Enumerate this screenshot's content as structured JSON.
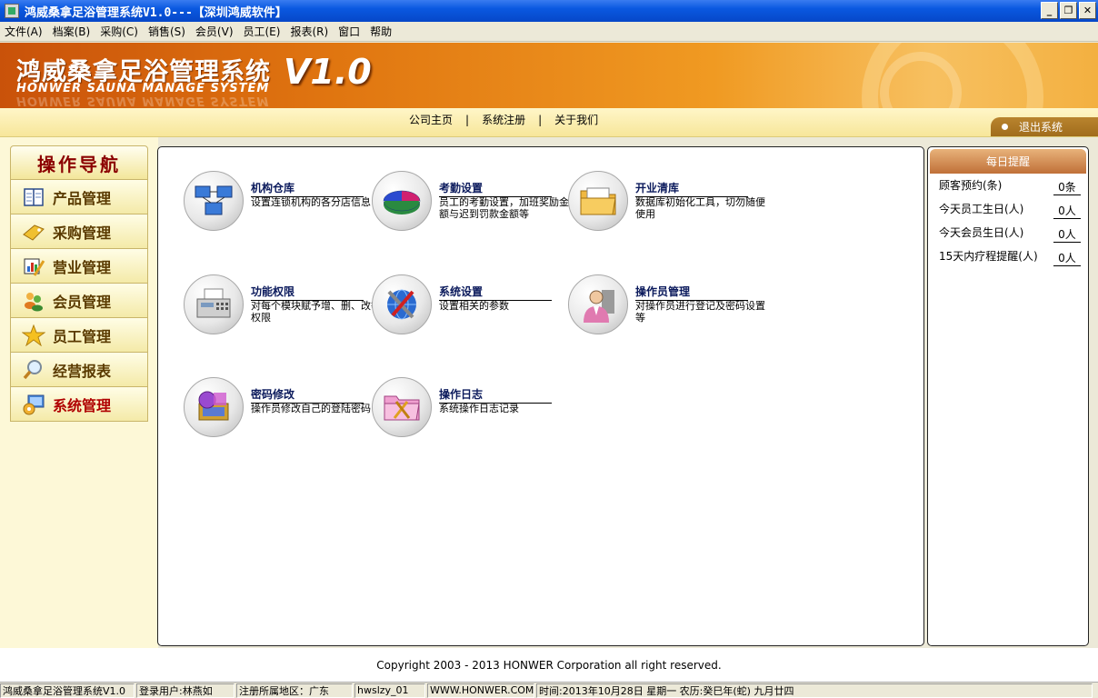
{
  "window": {
    "title": "鸿威桑拿足浴管理系统V1.0---【深圳鸿威软件】",
    "minimize": "_",
    "restore": "❐",
    "close": "✕"
  },
  "menu": [
    "文件(A)",
    "档案(B)",
    "采购(C)",
    "销售(S)",
    "会员(V)",
    "员工(E)",
    "报表(R)",
    "窗口",
    "帮助"
  ],
  "banner": {
    "brand_cn": "鸿威桑拿足浴管理系统",
    "brand_en": "HONWER SAUNA MANAGE SYSTEM",
    "version": "V1.0"
  },
  "topnav": {
    "links": [
      "公司主页",
      "系统注册",
      "关于我们"
    ],
    "separator": "|",
    "exit": "退出系统"
  },
  "leftnav": {
    "header": "操作导航",
    "items": [
      {
        "label": "产品管理",
        "icon": "book-icon"
      },
      {
        "label": "采购管理",
        "icon": "tag-icon"
      },
      {
        "label": "营业管理",
        "icon": "chart-pencil-icon"
      },
      {
        "label": "会员管理",
        "icon": "members-icon"
      },
      {
        "label": "员工管理",
        "icon": "star-icon"
      },
      {
        "label": "经营报表",
        "icon": "magnifier-icon"
      },
      {
        "label": "系统管理",
        "icon": "monitor-gear-icon"
      }
    ],
    "active_index": 6
  },
  "tiles": [
    {
      "title": "机构仓库",
      "desc": "设置连锁机构的各分店信息",
      "icon": "network-computers-icon"
    },
    {
      "title": "考勤设置",
      "desc": "员工的考勤设置，加班奖励金额与迟到罚款金额等",
      "icon": "pie-chart-icon"
    },
    {
      "title": "开业清库",
      "desc": "数据库初始化工具，切勿随便使用",
      "icon": "folder-icon"
    },
    {
      "title": "功能权限",
      "desc": "对每个模块赋予增、删、改等权限",
      "icon": "fax-machine-icon"
    },
    {
      "title": "系统设置",
      "desc": "设置相关的参数",
      "icon": "globe-tools-icon"
    },
    {
      "title": "操作员管理",
      "desc": "对操作员进行登记及密码设置等",
      "icon": "operator-icon"
    },
    {
      "title": "密码修改",
      "desc": "操作员修改自己的登陆密码",
      "icon": "password-icon"
    },
    {
      "title": "操作日志",
      "desc": "系统操作日志记录",
      "icon": "log-folder-icon"
    }
  ],
  "reminders": {
    "title": "每日提醒",
    "rows": [
      {
        "label": "顾客预约(条)",
        "value": "0条"
      },
      {
        "label": "今天员工生日(人)",
        "value": "0人"
      },
      {
        "label": "今天会员生日(人)",
        "value": "0人"
      },
      {
        "label": "15天内疗程提醒(人)",
        "value": "0人"
      }
    ]
  },
  "footer": "Copyright 2003 - 2013 HONWER Corporation all right reserved.",
  "statusbar": [
    "鸿威桑拿足浴管理系统V1.0",
    "登录用户:林燕如",
    "注册所属地区：广东",
    "hwslzy_01",
    "WWW.HONWER.COM",
    "时间:2013年10月28日  星期一  农历:癸巳年(蛇) 九月廿四"
  ],
  "colors": {
    "banner_orange": "#e07510",
    "nav_text": "#5a3a00",
    "active_nav": "#b00000",
    "tile_title": "#0b1a5c"
  }
}
